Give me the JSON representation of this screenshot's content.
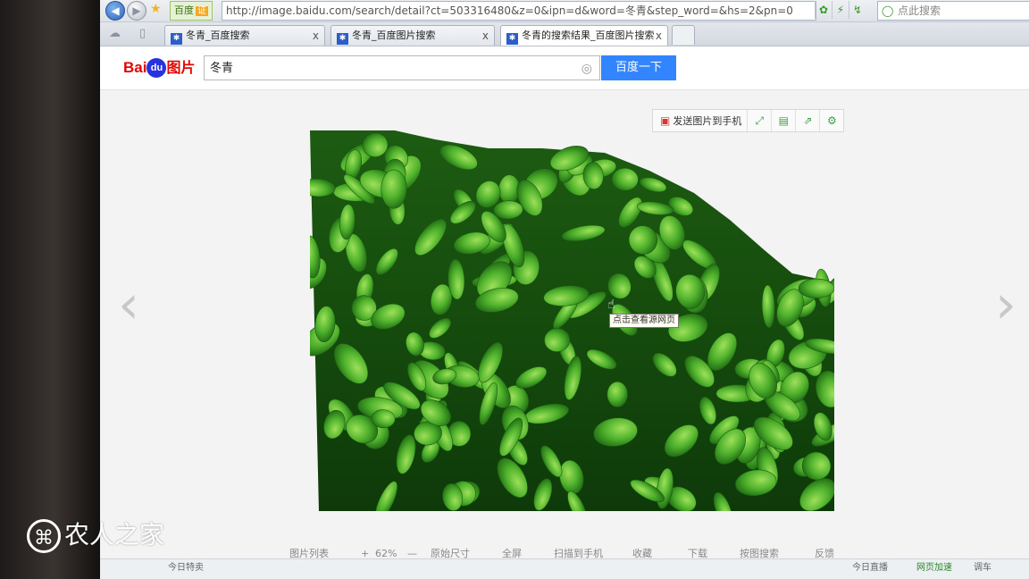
{
  "browser": {
    "site_badge": "百度",
    "site_badge_verified": "证",
    "url": "http://image.baidu.com/search/detail?ct=503316480&z=0&ipn=d&word=冬青&step_word=&hs=2&pn=0",
    "search_placeholder": "点此搜索",
    "tabs": [
      {
        "label": "冬青_百度搜索",
        "close": "x"
      },
      {
        "label": "冬青_百度图片搜索",
        "close": "x"
      },
      {
        "label": "冬青的搜索结果_百度图片搜索",
        "close": "x"
      }
    ]
  },
  "baidu": {
    "logo_text": "Bai",
    "logo_du": "du",
    "logo_pic": "图片",
    "query": "冬青",
    "search_button": "百度一下"
  },
  "viewer": {
    "send_to_phone": "发送图片到手机",
    "tooltip": "点击查看源网页",
    "toolbar": {
      "list": "图片列表",
      "zoom_in": "+",
      "zoom": "62%",
      "zoom_out": "—",
      "original_size": "原始尺寸",
      "fullscreen": "全屏",
      "scan_to_phone": "扫描到手机",
      "collect": "收藏",
      "download": "下载",
      "search_by_image": "按图搜索",
      "feedback": "反馈"
    }
  },
  "status": {
    "left": "今日特卖",
    "live": "今日直播",
    "speed": "网页加速",
    "item": "调车"
  },
  "watermark": "农人之家",
  "colors": {
    "baidu_red": "#e10602",
    "baidu_blue": "#2932e1",
    "button_blue": "#3385ff",
    "leaf_green": "#3f9e2b"
  },
  "icons": [
    "back-icon",
    "forward-icon",
    "star-icon",
    "camera-icon",
    "fullscreen-icon",
    "save-icon",
    "share-icon",
    "settings-icon",
    "prev-arrow-icon",
    "next-arrow-icon",
    "cursor-icon"
  ]
}
